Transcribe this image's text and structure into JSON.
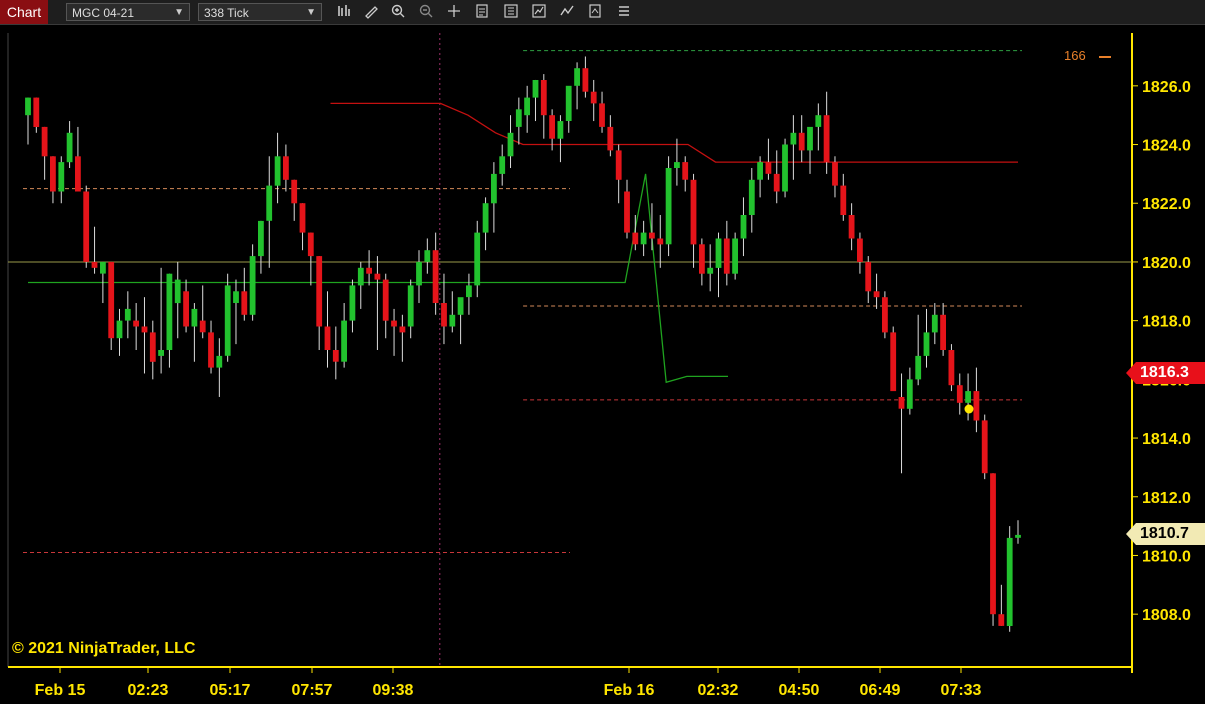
{
  "toolbar": {
    "tab_label": "Chart",
    "instrument": "MGC 04-21",
    "interval": "338 Tick",
    "icons": [
      "bar-type-icon",
      "draw-pencil-icon",
      "zoom-in-icon",
      "zoom-out-icon",
      "crosshair-icon",
      "data-box-icon",
      "properties-icon",
      "strategies-icon",
      "indicators-icon",
      "templates-icon",
      "menu-icon"
    ]
  },
  "chart": {
    "copyright": "© 2021 NinjaTrader, LLC",
    "last_price": "1816.3",
    "cursor_price": "1810.7",
    "marker_label": "166",
    "y_ticks": [
      "1826.0",
      "1824.0",
      "1822.0",
      "1820.0",
      "1818.0",
      "1816.0",
      "1814.0",
      "1812.0",
      "1810.0",
      "1808.0"
    ],
    "x_ticks": [
      "Feb 15",
      "02:23",
      "05:17",
      "07:57",
      "09:38",
      "Feb 16",
      "02:32",
      "04:50",
      "06:49",
      "07:33"
    ],
    "colors": {
      "up": "#22c22e",
      "down": "#e5141a",
      "axis": "#ffe600",
      "upper_band": "#c41010",
      "lower_band": "#1fa31f"
    }
  },
  "chart_data": {
    "type": "candlestick",
    "ylim": [
      1806.2,
      1827.8
    ],
    "ohlc": [
      [
        1825.0,
        1825.6,
        1824.0,
        1825.6
      ],
      [
        1825.6,
        1825.6,
        1824.4,
        1824.6
      ],
      [
        1824.6,
        1824.6,
        1822.8,
        1823.6
      ],
      [
        1823.6,
        1823.6,
        1822.0,
        1822.4
      ],
      [
        1822.4,
        1823.6,
        1822.0,
        1823.4
      ],
      [
        1823.4,
        1824.8,
        1823.2,
        1824.4
      ],
      [
        1823.6,
        1824.6,
        1822.8,
        1822.4
      ],
      [
        1822.4,
        1822.6,
        1819.8,
        1820.0
      ],
      [
        1820.0,
        1821.2,
        1819.6,
        1819.8
      ],
      [
        1819.6,
        1820.0,
        1818.6,
        1820.0
      ],
      [
        1820.0,
        1820.0,
        1817.0,
        1817.4
      ],
      [
        1817.4,
        1818.4,
        1816.8,
        1818.0
      ],
      [
        1818.0,
        1819.0,
        1817.4,
        1818.4
      ],
      [
        1818.0,
        1818.6,
        1817.0,
        1817.8
      ],
      [
        1817.8,
        1818.8,
        1816.2,
        1817.6
      ],
      [
        1817.6,
        1818.0,
        1816.0,
        1816.6
      ],
      [
        1816.8,
        1819.8,
        1816.2,
        1817.0
      ],
      [
        1817.0,
        1819.6,
        1816.4,
        1819.6
      ],
      [
        1818.6,
        1820.0,
        1817.4,
        1819.4
      ],
      [
        1819.0,
        1819.4,
        1817.6,
        1817.8
      ],
      [
        1817.8,
        1818.6,
        1816.6,
        1818.4
      ],
      [
        1818.0,
        1819.2,
        1817.4,
        1817.6
      ],
      [
        1817.6,
        1818.0,
        1816.2,
        1816.4
      ],
      [
        1816.4,
        1817.4,
        1815.4,
        1816.8
      ],
      [
        1816.8,
        1819.6,
        1816.6,
        1819.2
      ],
      [
        1818.6,
        1819.4,
        1817.2,
        1819.0
      ],
      [
        1819.0,
        1819.8,
        1818.0,
        1818.2
      ],
      [
        1818.2,
        1820.6,
        1818.0,
        1820.2
      ],
      [
        1820.2,
        1821.4,
        1819.6,
        1821.4
      ],
      [
        1821.4,
        1823.6,
        1819.8,
        1822.6
      ],
      [
        1822.6,
        1824.4,
        1822.0,
        1823.6
      ],
      [
        1823.6,
        1824.0,
        1822.4,
        1822.8
      ],
      [
        1822.8,
        1822.8,
        1821.4,
        1822.0
      ],
      [
        1822.0,
        1822.0,
        1820.4,
        1821.0
      ],
      [
        1821.0,
        1821.0,
        1819.2,
        1820.2
      ],
      [
        1820.2,
        1820.2,
        1817.0,
        1817.8
      ],
      [
        1817.8,
        1819.0,
        1816.4,
        1817.0
      ],
      [
        1817.0,
        1817.8,
        1816.0,
        1816.6
      ],
      [
        1816.6,
        1818.6,
        1816.4,
        1818.0
      ],
      [
        1818.0,
        1819.4,
        1817.6,
        1819.2
      ],
      [
        1819.2,
        1820.0,
        1818.4,
        1819.8
      ],
      [
        1819.8,
        1820.4,
        1819.2,
        1819.6
      ],
      [
        1819.6,
        1820.2,
        1817.0,
        1819.4
      ],
      [
        1819.4,
        1819.6,
        1817.4,
        1818.0
      ],
      [
        1818.0,
        1818.4,
        1816.8,
        1817.8
      ],
      [
        1817.8,
        1818.2,
        1816.6,
        1817.6
      ],
      [
        1817.8,
        1819.4,
        1817.4,
        1819.2
      ],
      [
        1819.2,
        1820.4,
        1818.6,
        1820.0
      ],
      [
        1820.0,
        1820.8,
        1819.6,
        1820.4
      ],
      [
        1820.4,
        1821.0,
        1818.2,
        1818.6
      ],
      [
        1818.6,
        1819.6,
        1817.2,
        1817.8
      ],
      [
        1817.8,
        1819.0,
        1817.6,
        1818.2
      ],
      [
        1818.2,
        1818.6,
        1817.2,
        1818.8
      ],
      [
        1818.8,
        1819.6,
        1818.2,
        1819.2
      ],
      [
        1819.2,
        1821.4,
        1818.8,
        1821.0
      ],
      [
        1821.0,
        1822.2,
        1820.4,
        1822.0
      ],
      [
        1822.0,
        1823.4,
        1821.0,
        1823.0
      ],
      [
        1823.0,
        1824.0,
        1822.6,
        1823.6
      ],
      [
        1823.6,
        1825.0,
        1823.2,
        1824.4
      ],
      [
        1824.6,
        1825.6,
        1824.0,
        1825.2
      ],
      [
        1825.0,
        1826.0,
        1824.4,
        1825.6
      ],
      [
        1825.6,
        1826.2,
        1824.8,
        1826.2
      ],
      [
        1826.2,
        1826.4,
        1824.2,
        1825.0
      ],
      [
        1825.0,
        1825.2,
        1823.8,
        1824.2
      ],
      [
        1824.2,
        1825.0,
        1823.4,
        1824.8
      ],
      [
        1824.8,
        1825.8,
        1824.4,
        1826.0
      ],
      [
        1826.0,
        1826.8,
        1825.2,
        1826.6
      ],
      [
        1826.6,
        1827.0,
        1825.6,
        1825.8
      ],
      [
        1825.8,
        1826.2,
        1824.8,
        1825.4
      ],
      [
        1825.4,
        1825.8,
        1824.4,
        1824.6
      ],
      [
        1824.6,
        1825.0,
        1823.6,
        1823.8
      ],
      [
        1823.8,
        1824.0,
        1822.0,
        1822.8
      ],
      [
        1822.4,
        1822.8,
        1820.8,
        1821.0
      ],
      [
        1821.0,
        1821.6,
        1820.4,
        1820.6
      ],
      [
        1820.6,
        1821.4,
        1820.2,
        1821.0
      ],
      [
        1821.0,
        1822.0,
        1820.4,
        1820.8
      ],
      [
        1820.8,
        1821.6,
        1819.8,
        1820.6
      ],
      [
        1820.6,
        1823.6,
        1820.2,
        1823.2
      ],
      [
        1823.2,
        1824.2,
        1822.6,
        1823.4
      ],
      [
        1823.4,
        1823.6,
        1822.4,
        1822.8
      ],
      [
        1822.8,
        1823.0,
        1819.8,
        1820.6
      ],
      [
        1820.6,
        1820.8,
        1819.2,
        1819.6
      ],
      [
        1819.6,
        1820.6,
        1819.0,
        1819.8
      ],
      [
        1819.8,
        1821.0,
        1818.8,
        1820.8
      ],
      [
        1820.8,
        1821.4,
        1819.2,
        1819.6
      ],
      [
        1819.6,
        1821.0,
        1819.4,
        1820.8
      ],
      [
        1820.8,
        1822.2,
        1820.2,
        1821.6
      ],
      [
        1821.6,
        1823.2,
        1821.0,
        1822.8
      ],
      [
        1822.8,
        1823.6,
        1822.2,
        1823.4
      ],
      [
        1823.4,
        1824.2,
        1822.8,
        1823.0
      ],
      [
        1823.0,
        1823.8,
        1822.0,
        1822.4
      ],
      [
        1822.4,
        1824.2,
        1822.2,
        1824.0
      ],
      [
        1824.0,
        1825.0,
        1822.8,
        1824.4
      ],
      [
        1824.4,
        1825.0,
        1823.4,
        1823.8
      ],
      [
        1823.8,
        1824.4,
        1823.0,
        1824.6
      ],
      [
        1824.6,
        1825.4,
        1823.8,
        1825.0
      ],
      [
        1825.0,
        1825.8,
        1823.0,
        1823.4
      ],
      [
        1823.4,
        1823.6,
        1822.2,
        1822.6
      ],
      [
        1822.6,
        1823.0,
        1821.4,
        1821.6
      ],
      [
        1821.6,
        1822.0,
        1820.4,
        1820.8
      ],
      [
        1820.8,
        1821.0,
        1819.6,
        1820.0
      ],
      [
        1820.0,
        1820.2,
        1818.6,
        1819.0
      ],
      [
        1819.0,
        1819.6,
        1818.4,
        1818.8
      ],
      [
        1818.8,
        1819.0,
        1817.4,
        1817.6
      ],
      [
        1817.6,
        1817.8,
        1816.0,
        1815.6
      ],
      [
        1815.4,
        1816.2,
        1812.8,
        1815.0
      ],
      [
        1815.0,
        1816.4,
        1814.8,
        1816.0
      ],
      [
        1816.0,
        1818.2,
        1815.8,
        1816.8
      ],
      [
        1816.8,
        1818.4,
        1816.4,
        1817.6
      ],
      [
        1817.6,
        1818.6,
        1817.2,
        1818.2
      ],
      [
        1818.2,
        1818.6,
        1816.8,
        1817.0
      ],
      [
        1817.0,
        1817.2,
        1815.6,
        1815.8
      ],
      [
        1815.8,
        1816.2,
        1814.8,
        1815.2
      ],
      [
        1815.2,
        1816.2,
        1814.6,
        1815.6
      ],
      [
        1815.6,
        1816.4,
        1814.2,
        1814.6
      ],
      [
        1814.6,
        1814.8,
        1812.6,
        1812.8
      ],
      [
        1812.8,
        1812.8,
        1807.6,
        1808.0
      ],
      [
        1808.0,
        1809.0,
        1807.6,
        1807.6
      ],
      [
        1807.6,
        1811.0,
        1807.4,
        1810.6
      ],
      [
        1810.6,
        1811.2,
        1810.4,
        1810.7
      ]
    ],
    "upper_band": [
      null,
      null,
      null,
      null,
      null,
      null,
      null,
      null,
      null,
      null,
      null,
      1825.4,
      1825.4,
      1825.4,
      1825.4,
      1825.4,
      1825.0,
      1824.4,
      1824.0,
      1824.0,
      1824.0,
      1824.0,
      1824.0,
      1824.0,
      1824.0,
      1823.4,
      1823.4,
      1823.4,
      1823.4,
      1823.4,
      1823.4,
      1823.4,
      1823.4,
      1823.4,
      1823.4,
      1823.4,
      1823.4
    ],
    "lower_band": [
      1819.3,
      1819.3,
      1819.3,
      1819.3,
      1819.3,
      1819.3,
      1819.3,
      1819.3,
      1819.3,
      1819.3,
      1819.3,
      1819.3,
      1819.3,
      1819.3,
      1819.3,
      1819.3,
      1819.3,
      1819.3,
      1819.3,
      1819.3,
      1819.3,
      1819.3,
      1819.3,
      1819.3,
      1819.3,
      1819.3,
      1819.3,
      1819.3,
      1819.3,
      1819.3,
      1823.0,
      1815.9,
      1816.1,
      1816.1,
      1816.1
    ],
    "horizontal_levels": [
      {
        "price": 1822.5,
        "color": "#d58a5a",
        "from": 0.0,
        "to": 0.5
      },
      {
        "price": 1810.1,
        "color": "#c8373a",
        "from": 0.0,
        "to": 0.5
      },
      {
        "price": 1827.2,
        "color": "#2ea043",
        "from": 0.51,
        "to": 1.0
      },
      {
        "price": 1818.5,
        "color": "#d58a5a",
        "from": 0.51,
        "to": 1.0
      },
      {
        "price": 1815.3,
        "color": "#c8373a",
        "from": 0.51,
        "to": 1.0
      }
    ],
    "horizontal_cursor_price": 1820.0,
    "session_break_index": 50
  }
}
